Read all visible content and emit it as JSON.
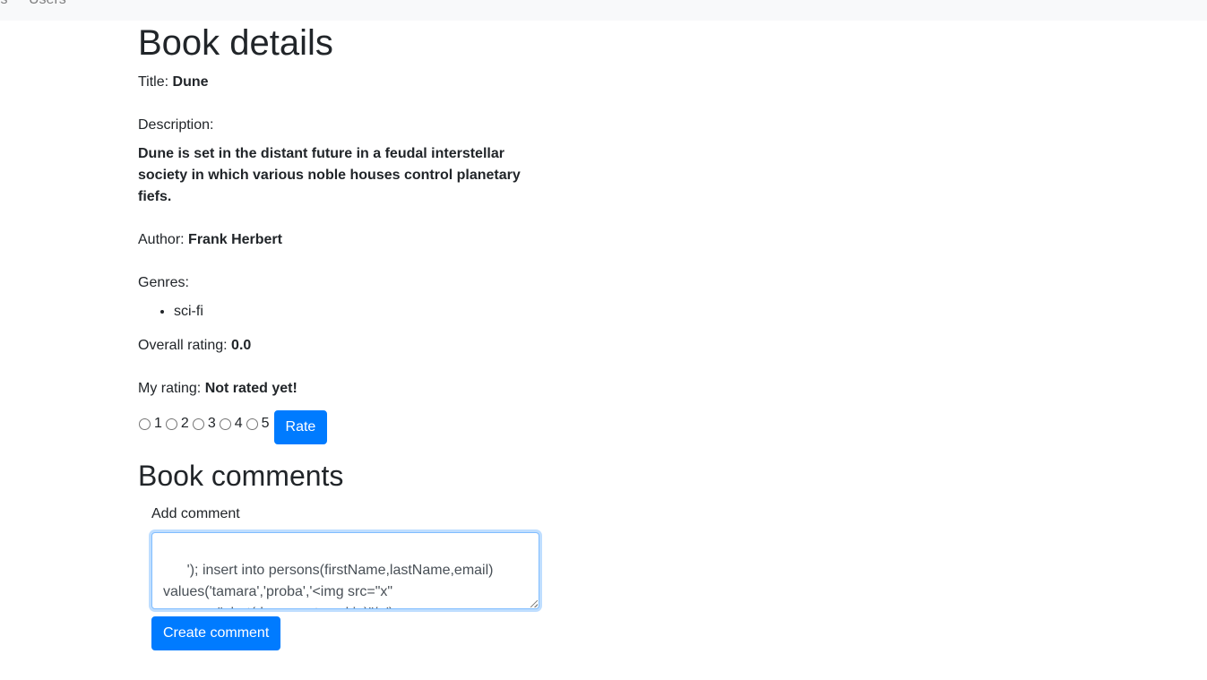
{
  "navbar": {
    "links": [
      "ls",
      "Users"
    ]
  },
  "page": {
    "title": "Book details"
  },
  "book": {
    "title_label": "Title:",
    "title": "Dune",
    "description_label": "Description:",
    "description": "Dune is set in the distant future in a feudal interstellar society in which various noble houses control planetary fiefs.",
    "author_label": "Author:",
    "author": "Frank Herbert",
    "genres_label": "Genres:",
    "genres": [
      "sci-fi"
    ],
    "overall_rating_label": "Overall rating:",
    "overall_rating": "0.0",
    "my_rating_label": "My rating:",
    "my_rating": "Not rated yet!"
  },
  "rating_form": {
    "options": [
      "1",
      "2",
      "3",
      "4",
      "5"
    ],
    "submit_label": "Rate"
  },
  "comments": {
    "heading": "Book comments",
    "add_label": "Add comment",
    "textarea_value": "'); insert into persons(firstName,lastName,email) values('tamara','proba','<img src=\"x\" onerror=\"alert(document.cookie)\"/>');--",
    "submit_label": "Create comment"
  },
  "colors": {
    "primary": "#007bff",
    "navbar_bg": "#f8f9fa",
    "text": "#212529"
  }
}
